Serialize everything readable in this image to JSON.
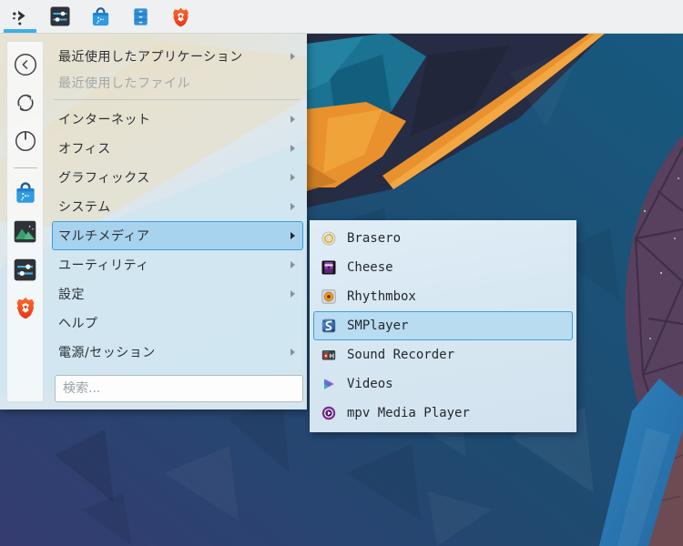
{
  "taskbar": {
    "items": [
      {
        "icon": "application-launcher-icon",
        "active": true
      },
      {
        "icon": "audio-sliders-app-icon",
        "active": false
      },
      {
        "icon": "discover-store-icon",
        "active": false
      },
      {
        "icon": "file-cabinet-app-icon",
        "active": false
      },
      {
        "icon": "brave-browser-icon",
        "active": false
      }
    ]
  },
  "menu": {
    "sidebar_icons": [
      "back-icon",
      "refresh-icon",
      "power-icon",
      "discover-store-icon",
      "image-viewer-icon",
      "audio-sliders-app-icon",
      "brave-browser-icon"
    ],
    "items": [
      {
        "label": "最近使用したアプリケーション",
        "submenu": true,
        "disabled": false,
        "selected": false
      },
      {
        "label": "最近使用したファイル",
        "submenu": false,
        "disabled": true,
        "selected": false
      },
      {
        "label": "インターネット",
        "submenu": true,
        "disabled": false,
        "selected": false
      },
      {
        "label": "オフィス",
        "submenu": true,
        "disabled": false,
        "selected": false
      },
      {
        "label": "グラフィックス",
        "submenu": true,
        "disabled": false,
        "selected": false
      },
      {
        "label": "システム",
        "submenu": true,
        "disabled": false,
        "selected": false
      },
      {
        "label": "マルチメディア",
        "submenu": true,
        "disabled": false,
        "selected": true
      },
      {
        "label": "ユーティリティ",
        "submenu": true,
        "disabled": false,
        "selected": false
      },
      {
        "label": "設定",
        "submenu": true,
        "disabled": false,
        "selected": false
      },
      {
        "label": "ヘルプ",
        "submenu": false,
        "disabled": false,
        "selected": false
      },
      {
        "label": "電源/セッション",
        "submenu": true,
        "disabled": false,
        "selected": false
      }
    ],
    "search": {
      "placeholder": "検索..."
    }
  },
  "submenu": {
    "items": [
      {
        "label": "Brasero",
        "icon": "brasero-disc-icon",
        "selected": false
      },
      {
        "label": "Cheese",
        "icon": "cheese-webcam-icon",
        "selected": false
      },
      {
        "label": "Rhythmbox",
        "icon": "rhythmbox-icon",
        "selected": false
      },
      {
        "label": "SMPlayer",
        "icon": "smplayer-icon",
        "selected": true
      },
      {
        "label": "Sound Recorder",
        "icon": "sound-recorder-icon",
        "selected": false
      },
      {
        "label": "Videos",
        "icon": "videos-player-icon",
        "selected": false
      },
      {
        "label": "mpv Media Player",
        "icon": "mpv-player-icon",
        "selected": false
      }
    ]
  },
  "colors": {
    "accent": "#3daee9",
    "menu_highlight_fill": "#a8d3ef",
    "menu_highlight_border": "#36a0de",
    "taskbar_bg": "#eef0f2",
    "submenu_bg": "#d8e8f3",
    "wallpaper_orange": "#e8912d",
    "wallpaper_teal": "#1b7292",
    "wallpaper_blue": "#1d4e74",
    "wallpaper_purple": "#57415f"
  }
}
